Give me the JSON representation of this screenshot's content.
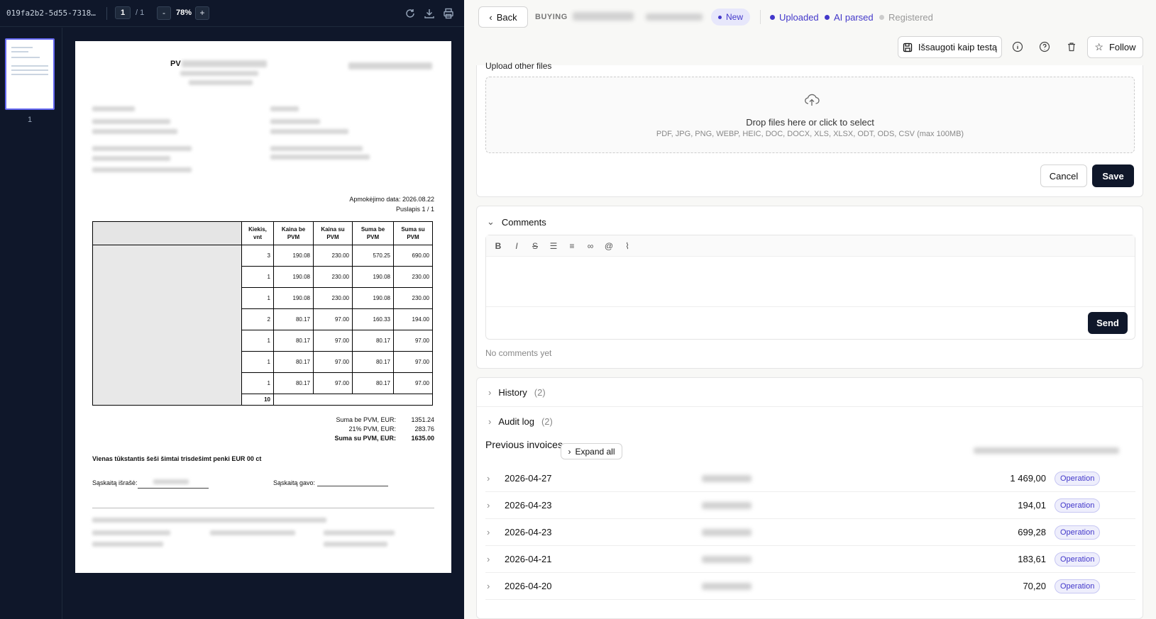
{
  "viewer": {
    "file_name": "019fa2b2-5d55-7318…",
    "page_current": "1",
    "page_total": "/ 1",
    "zoom_out": "-",
    "zoom": "78%",
    "zoom_in": "+",
    "thumb_label": "1"
  },
  "document": {
    "title_partial": "PV",
    "payment_date": "Apmokėjimo data: 2026.08.22",
    "page_info": "Puslapis 1 / 1",
    "headers": [
      "Kiekis, vnt",
      "Kaina be PVM",
      "Kaina su PVM",
      "Suma be PVM",
      "Suma su PVM"
    ],
    "rows": [
      [
        "3",
        "190.08",
        "230.00",
        "570.25",
        "690.00"
      ],
      [
        "1",
        "190.08",
        "230.00",
        "190.08",
        "230.00"
      ],
      [
        "1",
        "190.08",
        "230.00",
        "190.08",
        "230.00"
      ],
      [
        "2",
        "80.17",
        "97.00",
        "160.33",
        "194.00"
      ],
      [
        "1",
        "80.17",
        "97.00",
        "80.17",
        "97.00"
      ],
      [
        "1",
        "80.17",
        "97.00",
        "80.17",
        "97.00"
      ],
      [
        "1",
        "80.17",
        "97.00",
        "80.17",
        "97.00"
      ]
    ],
    "qty_total": "10",
    "totals": [
      {
        "label": "Suma be PVM, EUR:",
        "value": "1351.24"
      },
      {
        "label": "21% PVM, EUR:",
        "value": "283.76"
      },
      {
        "label": "Suma su PVM, EUR:",
        "value": "1635.00"
      }
    ],
    "amount_words": "Vienas tūkstantis šeši šimtai trisdešimt penki EUR 00 ct",
    "issued_by": "Sąskaitą išrašė:",
    "received_by": "Sąskaitą gavo:"
  },
  "header": {
    "back_label": "Back",
    "type_label": "BUYING",
    "status_badge": "New",
    "steps": [
      {
        "label": "Uploaded",
        "color": "#4338ca"
      },
      {
        "label": "AI parsed",
        "color": "#4338ca"
      },
      {
        "label": "Registered",
        "color": "#bbbbbb"
      }
    ],
    "save_test_label": "Išsaugoti kaip testą",
    "follow_label": "Follow"
  },
  "upload": {
    "title": "Upload other files",
    "drop_main": "Drop files here or click to select",
    "drop_sub": "PDF, JPG, PNG, WEBP, HEIC, DOC, DOCX, XLS, XLSX, ODT, ODS, CSV (max 100MB)",
    "cancel_label": "Cancel",
    "save_label": "Save"
  },
  "comments": {
    "title": "Comments",
    "toolbar": [
      "B",
      "I",
      "S"
    ],
    "send_label": "Send",
    "empty": "No comments yet"
  },
  "history": {
    "label": "History",
    "count": "(2)"
  },
  "audit": {
    "label": "Audit log",
    "count": "(2)"
  },
  "previous": {
    "title": "Previous invoices",
    "expand_label": "Expand all",
    "rows": [
      {
        "date": "2026-04-27",
        "amount": "1 469,00",
        "tag": "Operation"
      },
      {
        "date": "2026-04-23",
        "amount": "194,01",
        "tag": "Operation"
      },
      {
        "date": "2026-04-23",
        "amount": "699,28",
        "tag": "Operation"
      },
      {
        "date": "2026-04-21",
        "amount": "183,61",
        "tag": "Operation"
      },
      {
        "date": "2026-04-20",
        "amount": "70,20",
        "tag": "Operation"
      }
    ]
  }
}
